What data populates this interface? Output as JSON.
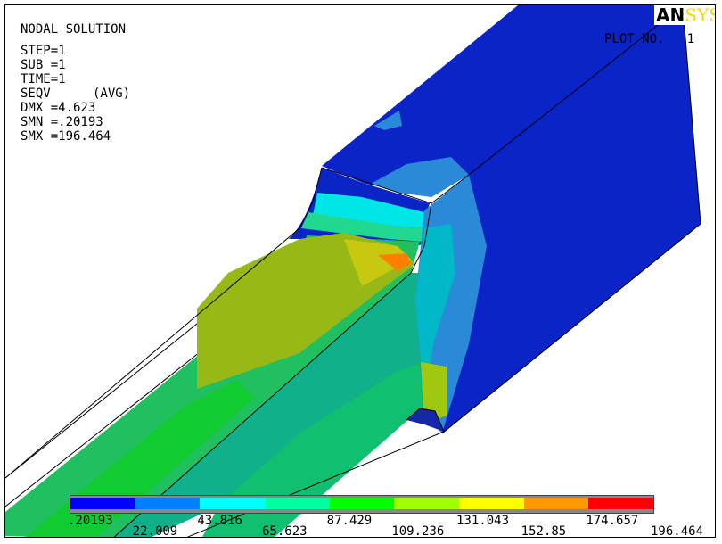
{
  "header": {
    "title": "NODAL SOLUTION",
    "step": "STEP=1",
    "sub": "SUB =1",
    "time": "TIME=1",
    "result": "SEQV",
    "avg": "(AVG)",
    "dmx": "DMX =4.623",
    "smn": "SMN =.20193",
    "smx": "SMX =196.464"
  },
  "logo": {
    "part1": "AN",
    "part2": "SYS"
  },
  "plot": {
    "label": "PLOT NO.",
    "number": "1"
  },
  "legend": {
    "colors": [
      "#0000ff",
      "#0080ff",
      "#00ffff",
      "#00ffa0",
      "#00ff00",
      "#a0ff00",
      "#ffff00",
      "#ff9900",
      "#ff0000"
    ],
    "labels_top": [
      ".20193",
      "43.816",
      "87.429",
      "131.043",
      "174.657"
    ],
    "labels_bottom": [
      "22.009",
      "65.623",
      "109.236",
      "152.85",
      "196.464"
    ]
  }
}
